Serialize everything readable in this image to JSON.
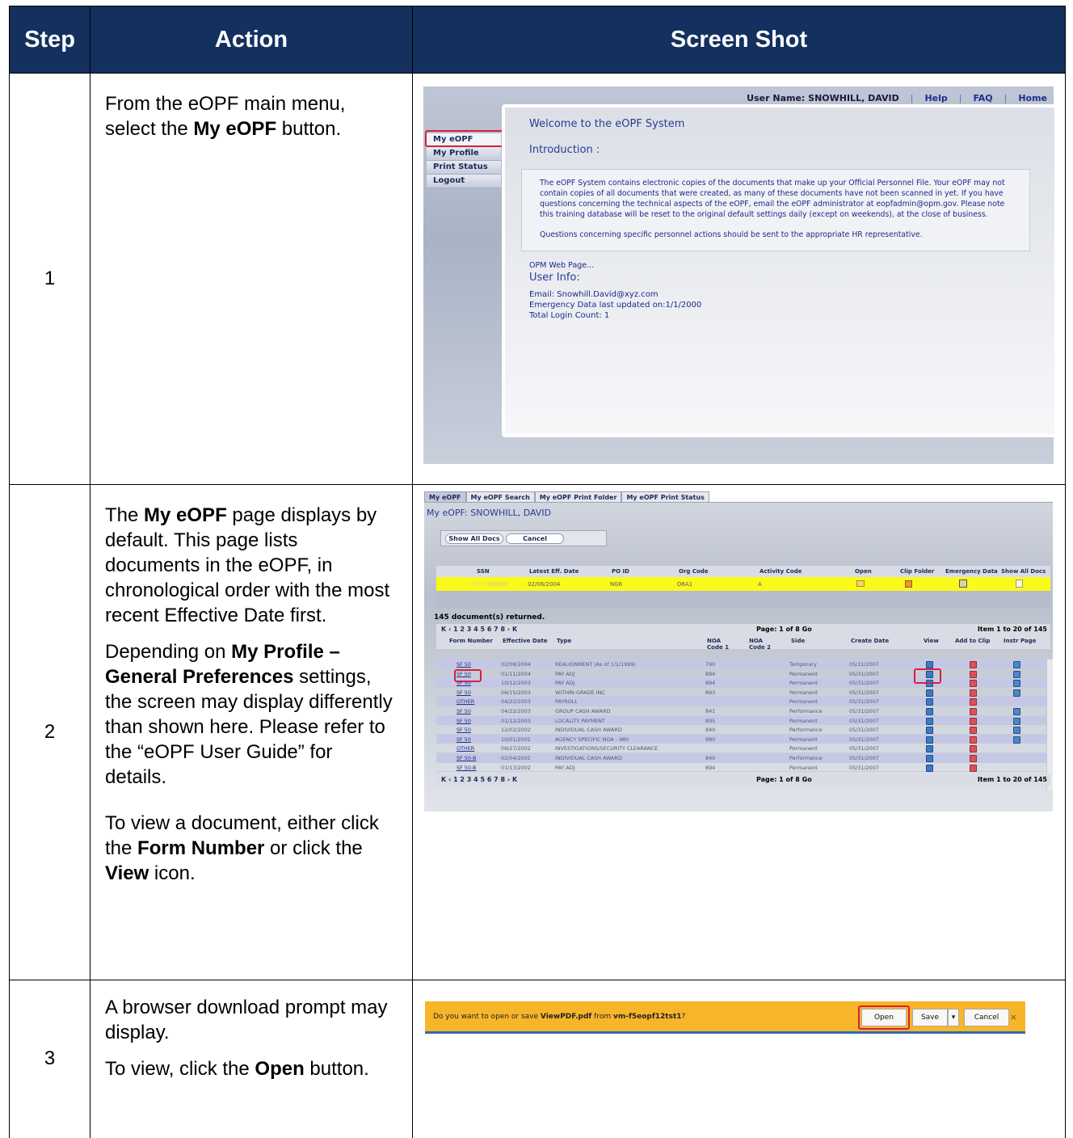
{
  "table": {
    "headers": [
      "Step",
      "Action",
      "Screen Shot"
    ]
  },
  "steps": [
    {
      "number": "1",
      "action_parts": [
        {
          "text": "From the eOPF main menu, select the "
        },
        {
          "text": "My eOPF",
          "bold": true
        },
        {
          "text": " button."
        }
      ],
      "screenshot": {
        "topbar": {
          "user_name": "User Name: SNOWHILL, DAVID",
          "help": "Help",
          "faq": "FAQ",
          "home": "Home"
        },
        "menu": [
          "My eOPF",
          "My Profile",
          "Print Status",
          "Logout"
        ],
        "welcome": "Welcome to the eOPF System",
        "introduction": "Introduction :",
        "intro_para1": "The eOPF System contains electronic copies of the documents that make up your Official Personnel File. Your eOPF may not contain copies of all documents that were created, as many of these documents have not been scanned in yet. If you have questions concerning the technical aspects of the eOPF, email the eOPF administrator at eopfadmin@opm.gov. Please note this training database will be reset to the original default settings daily (except on weekends), at the close of business.",
        "intro_para2": "Questions concerning specific personnel actions should be sent to the appropriate HR representative.",
        "opm_link": "OPM Web Page...",
        "user_info": "User Info:",
        "email": "Email: Snowhill.David@xyz.com",
        "emergency": "Emergency Data last updated on:1/1/2000",
        "login_count": "Total Login Count: 1"
      }
    },
    {
      "number": "2",
      "action_p1": [
        {
          "text": "The "
        },
        {
          "text": "My eOPF",
          "bold": true
        },
        {
          "text": " page displays by default. This page lists documents in the eOPF, in chronological order with the most recent Effective Date first."
        }
      ],
      "action_p2": [
        {
          "text": "Depending on "
        },
        {
          "text": "My Profile – General Preferences",
          "bold": true
        },
        {
          "text": " settings, the screen may display differently than shown here. Please refer to the “eOPF User Guide” for details."
        }
      ],
      "action_p3": [
        {
          "text": "To view a document, either click the "
        },
        {
          "text": "Form Number",
          "bold": true
        },
        {
          "text": " or click the "
        },
        {
          "text": "View",
          "bold": true
        },
        {
          "text": " icon."
        }
      ],
      "screenshot": {
        "tabs": [
          "My eOPF",
          "My eOPF Search",
          "My eOPF Print Folder",
          "My eOPF Print Status"
        ],
        "title": "My eOPF: SNOWHILL, DAVID",
        "buttons": {
          "show_all": "Show All Docs",
          "cancel": "Cancel"
        },
        "summary_headers": [
          "SSN",
          "Latest Eff. Date",
          "PO ID",
          "Org Code",
          "Activity Code",
          "Open",
          "Clip Folder",
          "Emergency Data",
          "Show All Docs"
        ],
        "summary_row": {
          "ssn": "***-**-####",
          "date": "02/08/2004",
          "po_id": "NG6",
          "org": "O6A1",
          "activity": "A"
        },
        "count": "145 document(s) returned.",
        "pager": {
          "numbers": "K ‹ 1 2 3 4 5 6 7 8 › K",
          "page": "Page: 1 of 8 Go",
          "items": "Item 1 to 20 of 145"
        },
        "grid_headers": [
          "Form Number",
          "Effective Date",
          "Type",
          "NOA Code 1",
          "NOA Code 2",
          "Side",
          "Create Date",
          "View",
          "Add to Clip",
          "Instr Page"
        ],
        "rows": [
          {
            "form": "SF 50",
            "date": "02/08/2004",
            "type": "REALIGNMENT (As of 1/1/1999)",
            "noa1": "790",
            "side": "Temporary",
            "create": "05/31/2007",
            "clip": true,
            "instr": true
          },
          {
            "form": "SF 50",
            "date": "01/11/2004",
            "type": "PAY ADJ",
            "noa1": "894",
            "side": "Permanent",
            "create": "05/31/2007",
            "clip": true,
            "instr": true
          },
          {
            "form": "SF 50",
            "date": "10/12/2003",
            "type": "PAY ADJ",
            "noa1": "894",
            "side": "Permanent",
            "create": "05/31/2007",
            "clip": true,
            "instr": true
          },
          {
            "form": "SF 50",
            "date": "06/15/2003",
            "type": "WITHIN-GRADE INC",
            "noa1": "893",
            "side": "Permanent",
            "create": "05/31/2007",
            "clip": true,
            "instr": true
          },
          {
            "form": "OTHER",
            "date": "04/22/2003",
            "type": "PAYROLL",
            "noa1": "",
            "side": "Permanent",
            "create": "05/31/2007",
            "clip": true,
            "instr": false
          },
          {
            "form": "SF 50",
            "date": "04/22/2003",
            "type": "GROUP CASH AWARD",
            "noa1": "841",
            "side": "Performance",
            "create": "05/31/2007",
            "clip": true,
            "instr": true
          },
          {
            "form": "SF 50",
            "date": "01/12/2003",
            "type": "LOCALITY PAYMENT",
            "noa1": "895",
            "side": "Permanent",
            "create": "05/31/2007",
            "clip": true,
            "instr": true
          },
          {
            "form": "SF 50",
            "date": "12/02/2002",
            "type": "INDIVIDUAL CASH AWARD",
            "noa1": "840",
            "side": "Performance",
            "create": "05/31/2007",
            "clip": true,
            "instr": true
          },
          {
            "form": "SF 50",
            "date": "10/01/2002",
            "type": "AGENCY SPECIFIC NOA - 980",
            "noa1": "980",
            "side": "Permanent",
            "create": "05/31/2007",
            "clip": true,
            "instr": true
          },
          {
            "form": "OTHER",
            "date": "06/27/2002",
            "type": "INVESTIGATIONS/SECURITY CLEARANCE",
            "noa1": "",
            "side": "Permanent",
            "create": "05/31/2007",
            "clip": true,
            "instr": false
          },
          {
            "form": "SF 50-B",
            "date": "02/04/2002",
            "type": "INDIVIDUAL CASH AWARD",
            "noa1": "840",
            "side": "Performance",
            "create": "05/31/2007",
            "clip": true,
            "instr": false
          },
          {
            "form": "SF 50-B",
            "date": "01/13/2002",
            "type": "PAY ADJ",
            "noa1": "894",
            "side": "Permanent",
            "create": "05/31/2007",
            "clip": true,
            "instr": false
          }
        ]
      }
    },
    {
      "number": "3",
      "action_p1": "A browser download prompt may display.",
      "action_p2": [
        {
          "text": "To view, click the "
        },
        {
          "text": "Open",
          "bold": true
        },
        {
          "text": " button."
        }
      ],
      "screenshot": {
        "message_prefix": "Do you want to open or save ",
        "file": "ViewPDF.pdf",
        "message_mid": " from ",
        "host": "vm-f5eopf12tst1",
        "message_suffix": "?",
        "open": "Open",
        "save": "Save",
        "cancel": "Cancel",
        "close": "×"
      }
    }
  ]
}
